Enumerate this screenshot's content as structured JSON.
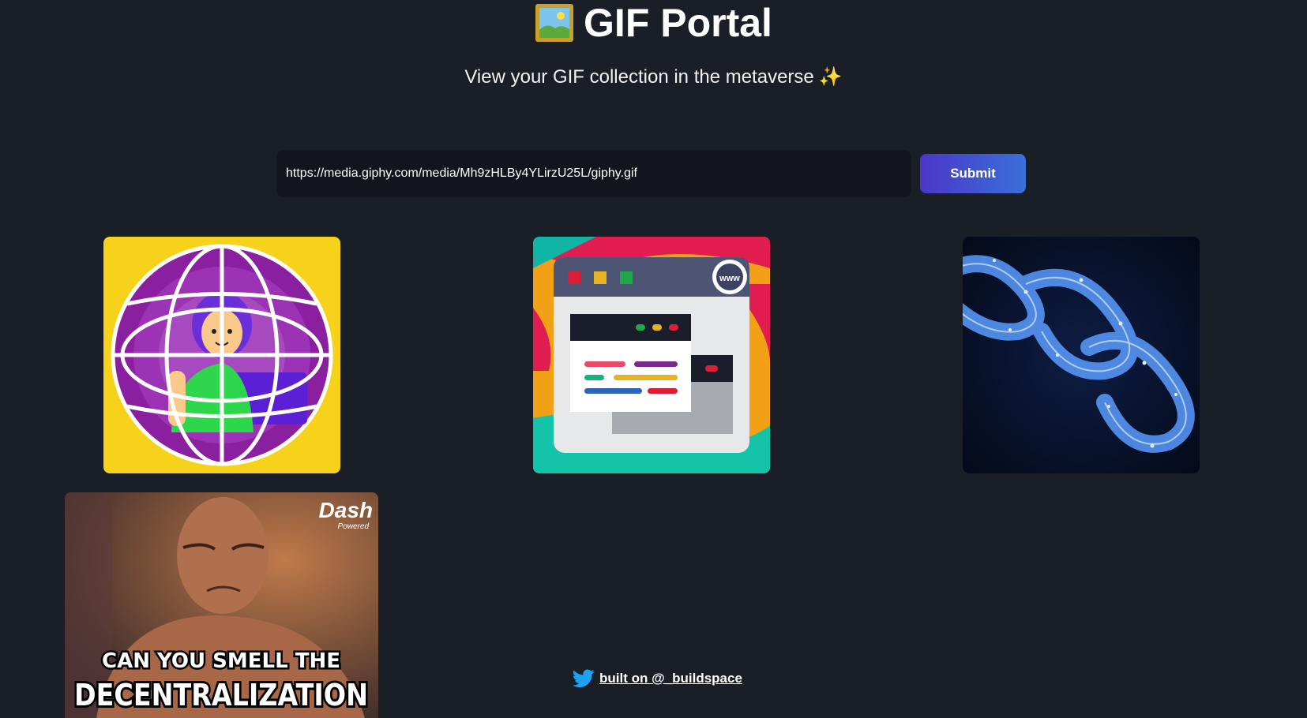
{
  "header": {
    "title": "GIF Portal",
    "title_icon": "framed-picture-icon",
    "subtitle": "View your GIF collection in the metaverse",
    "subtitle_icon": "sparkles-icon"
  },
  "form": {
    "input_value": "https://media.giphy.com/media/Mh9zHLBy4YLirzU25L/giphy.gif",
    "submit_label": "Submit"
  },
  "gifs": [
    {
      "description_icon": "globe-woman-laptop-gif"
    },
    {
      "description_icon": "browser-window-www-gif"
    },
    {
      "description_icon": "blue-chain-links-gif"
    },
    {
      "description_icon": "rock-meme-gif",
      "watermark": "Dash",
      "watermark_sub": "Powered",
      "caption_top": "CAN YOU SMELL THE",
      "caption_bottom": "DECENTRALIZATION"
    }
  ],
  "footer": {
    "icon": "twitter-bird-icon",
    "link_text": "built on @_buildspace"
  },
  "colors": {
    "background": "#1a1e27",
    "input_bg": "#12151b",
    "button_start": "#4b37c9",
    "button_end": "#3a6fd8",
    "twitter_blue": "#1da1f2"
  }
}
